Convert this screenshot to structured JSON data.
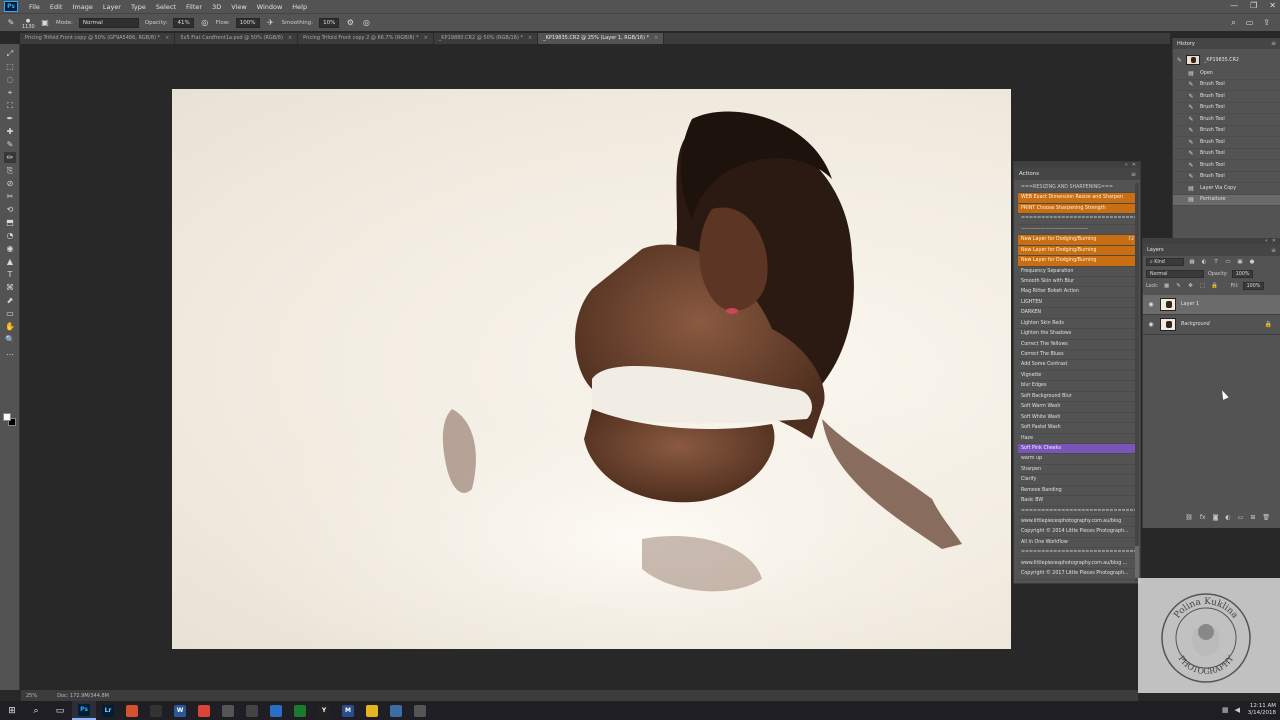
{
  "menubar": {
    "logo": "Ps",
    "items": [
      "File",
      "Edit",
      "Image",
      "Layer",
      "Type",
      "Select",
      "Filter",
      "3D",
      "View",
      "Window",
      "Help"
    ],
    "controls": [
      "—",
      "❐",
      "✕"
    ]
  },
  "options": {
    "brush_size": "1130",
    "mode_label": "Mode:",
    "mode_value": "Normal",
    "opacity_label": "Opacity:",
    "opacity_value": "41%",
    "flow_label": "Flow:",
    "flow_value": "100%",
    "smoothing_label": "Smoothing:",
    "smoothing_value": "10%"
  },
  "tabs": [
    {
      "label": "Pricing Trifold Front copy @ 50% (GF9A5486, RGB/8) *"
    },
    {
      "label": "5x5 Flat Cardfront1a.psd @ 50% (RGB/8)"
    },
    {
      "label": "Pricing Trifold Front copy 2 @ 66.7% (RGB/8) *"
    },
    {
      "label": "_KP19880.CR2 @ 50% (RGB/16) *"
    },
    {
      "label": "_KP19835.CR2 @ 25% (Layer 1, RGB/16) *"
    }
  ],
  "tools": [
    "⤢",
    "⬚",
    "◌",
    "⌖",
    "⛶",
    "✒",
    "✚",
    "✎",
    "⎘",
    "⊘",
    "✂",
    "⟲",
    "✏",
    "⬒",
    "◔",
    "✋",
    "◉",
    "▲",
    "T",
    "⌘",
    "⬈",
    "▭",
    "✋",
    "🔍",
    "…"
  ],
  "actions_panel": {
    "title": "Actions",
    "items": [
      {
        "label": "===RESIZING AND SHARPENING===",
        "style": "sep"
      },
      {
        "label": "WEB Exact Dimension Resize and Sharpen",
        "style": "orange"
      },
      {
        "label": "PRINT Choose Sharpening Strength",
        "style": "orange"
      },
      {
        "label": "==============================",
        "style": "sep"
      },
      {
        "label": "——————————————",
        "style": "sep"
      },
      {
        "label": "New Layer for Dodging/Burning",
        "style": "orange",
        "fkey": "F2"
      },
      {
        "label": "New Layer for Dodging/Burning",
        "style": "orange"
      },
      {
        "label": "New Layer for Dodging/Burning",
        "style": "orange"
      },
      {
        "label": "Frequency Separation",
        "style": ""
      },
      {
        "label": "Smooth Skin with Blur",
        "style": ""
      },
      {
        "label": "Mag Ritter Bokeh Action",
        "style": ""
      },
      {
        "label": "LIGHTEN",
        "style": ""
      },
      {
        "label": "DARKEN",
        "style": ""
      },
      {
        "label": "Lighten Skin Reds",
        "style": ""
      },
      {
        "label": "Lighten the Shadows",
        "style": ""
      },
      {
        "label": "Correct The Yellows",
        "style": ""
      },
      {
        "label": "Correct The Blues",
        "style": ""
      },
      {
        "label": "Add Some Contrast",
        "style": ""
      },
      {
        "label": "Vignette",
        "style": ""
      },
      {
        "label": "blur Edges",
        "style": ""
      },
      {
        "label": "Soft Background Blur",
        "style": ""
      },
      {
        "label": "Soft Warm Wash",
        "style": ""
      },
      {
        "label": "Soft White Wash",
        "style": ""
      },
      {
        "label": "Soft Pastel Wash",
        "style": ""
      },
      {
        "label": "Haze",
        "style": ""
      },
      {
        "label": "Soft Pink Cheeks",
        "style": "purple"
      },
      {
        "label": "warm up",
        "style": ""
      },
      {
        "label": "Sharpen",
        "style": ""
      },
      {
        "label": "Clarify",
        "style": ""
      },
      {
        "label": "Remove Banding",
        "style": ""
      },
      {
        "label": "Basic BW",
        "style": ""
      },
      {
        "label": "==============================",
        "style": "sep"
      },
      {
        "label": "www.littlepiecesphotography.com.au/blog",
        "style": ""
      },
      {
        "label": "Copyright © 2014 Little Pieces Photograph...",
        "style": ""
      },
      {
        "label": "All In One Workflow",
        "style": ""
      },
      {
        "label": "==============================",
        "style": "sep"
      },
      {
        "label": "www.littlepiecesphotography.com.au/blog ...",
        "style": ""
      },
      {
        "label": "Copyright © 2017 Little Pieces Photograph...",
        "style": ""
      }
    ]
  },
  "history_panel": {
    "title": "History",
    "snapshot": "_KP19835.CR2",
    "items": [
      {
        "label": "Open",
        "icon": "▤"
      },
      {
        "label": "Brush Tool",
        "icon": "✎"
      },
      {
        "label": "Brush Tool",
        "icon": "✎"
      },
      {
        "label": "Brush Tool",
        "icon": "✎"
      },
      {
        "label": "Brush Tool",
        "icon": "✎"
      },
      {
        "label": "Brush Tool",
        "icon": "✎"
      },
      {
        "label": "Brush Tool",
        "icon": "✎"
      },
      {
        "label": "Brush Tool",
        "icon": "✎"
      },
      {
        "label": "Brush Tool",
        "icon": "✎"
      },
      {
        "label": "Brush Tool",
        "icon": "✎"
      },
      {
        "label": "Layer Via Copy",
        "icon": "▤"
      },
      {
        "label": "Portraiture",
        "icon": "▤"
      }
    ]
  },
  "layers_panel": {
    "title": "Layers",
    "kind_label": "Kind",
    "blend_mode": "Normal",
    "opacity_label": "Opacity:",
    "opacity_value": "100%",
    "lock_label": "Lock:",
    "fill_label": "Fill:",
    "fill_value": "100%",
    "layers": [
      {
        "name": "Layer 1",
        "selected": true
      },
      {
        "name": "Background",
        "selected": false
      }
    ]
  },
  "watermark": {
    "line1": "Polina Kuklina",
    "line2": "PHOTOGRAPHY"
  },
  "status": {
    "zoom": "25%",
    "doc": "Doc: 172.9M/344.8M"
  },
  "taskbar": {
    "time": "12:11 AM",
    "date": "3/14/2018",
    "apps": [
      {
        "letter": "Ps",
        "color": "#001e36",
        "fg": "#31a8ff",
        "active": true
      },
      {
        "letter": "Lr",
        "color": "#001e36",
        "fg": "#9cc8ff",
        "active": false
      },
      {
        "letter": "",
        "color": "#d35230",
        "fg": "#fff",
        "active": false
      },
      {
        "letter": "",
        "color": "#333",
        "fg": "#fff",
        "active": false
      },
      {
        "letter": "W",
        "color": "#2b579a",
        "fg": "#fff",
        "active": false
      },
      {
        "letter": "",
        "color": "#db4437",
        "fg": "#fff",
        "active": false
      },
      {
        "letter": "",
        "color": "#555",
        "fg": "#fff",
        "active": false
      },
      {
        "letter": "",
        "color": "#444",
        "fg": "#fff",
        "active": false
      },
      {
        "letter": "",
        "color": "#2a6fc4",
        "fg": "#fff",
        "active": false
      },
      {
        "letter": "",
        "color": "#1a7a2e",
        "fg": "#fff",
        "active": false
      },
      {
        "letter": "Y",
        "color": "#222",
        "fg": "#fff",
        "active": false
      },
      {
        "letter": "M",
        "color": "#2a4b8c",
        "fg": "#fff",
        "active": false
      },
      {
        "letter": "",
        "color": "#e6b422",
        "fg": "#fff",
        "active": false
      },
      {
        "letter": "",
        "color": "#3a6ea5",
        "fg": "#fff",
        "active": false
      },
      {
        "letter": "",
        "color": "#555",
        "fg": "#fff",
        "active": false
      }
    ]
  }
}
